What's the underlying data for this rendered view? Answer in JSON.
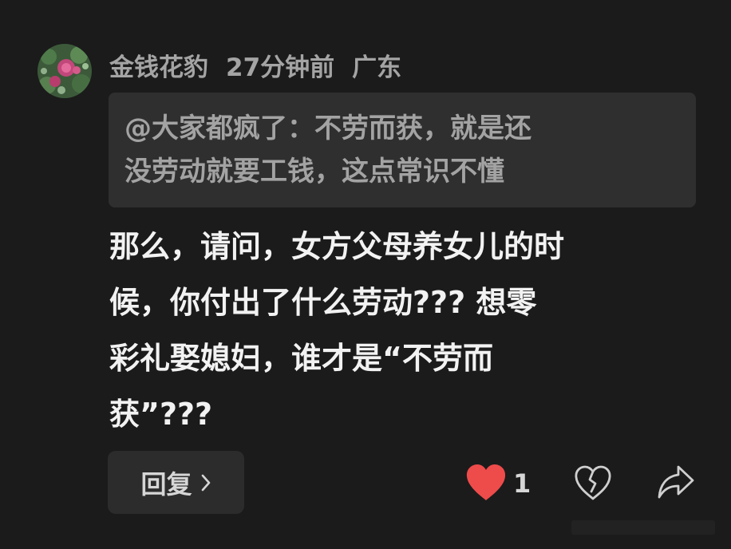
{
  "comment": {
    "username": "金钱花豹",
    "time": "27分钟前",
    "location": "广东",
    "quote": "@大家都疯了：不劳而获，就是还\n没劳动就要工钱，这点常识不懂",
    "body": "那么，请问，女方父母养女儿的时\n候，你付出了什么劳动??? 想零\n彩礼娶媳妇，谁才是“不劳而\n获”???"
  },
  "actions": {
    "reply_label": "回复",
    "reply_icon": "chevron-right-icon",
    "like_icon": "heart-icon",
    "like_count": "1",
    "dislike_icon": "broken-heart-icon",
    "share_icon": "share-arrow-icon"
  },
  "colors": {
    "background": "#1b1b1b",
    "quote_background": "#2f2f2f",
    "like_red": "#ee4b4b",
    "meta_gray": "#a4a4a4",
    "body_white": "#f2f2f2"
  }
}
